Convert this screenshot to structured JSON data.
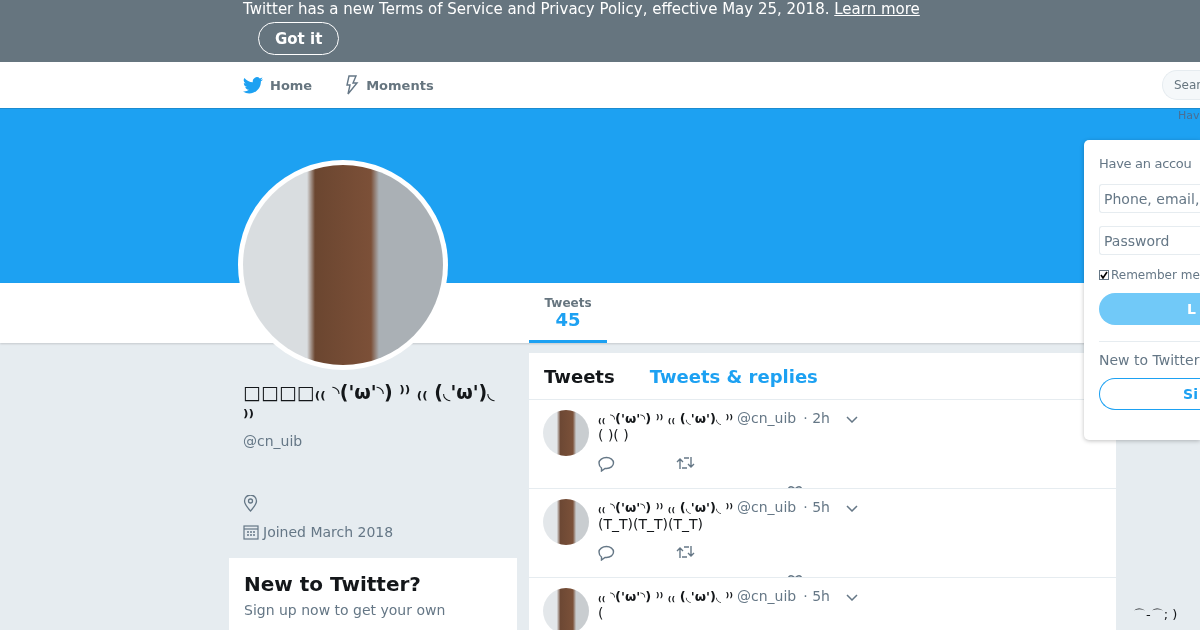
{
  "banner": {
    "text": "Twitter has a new Terms of Service and Privacy Policy, effective May 25, 2018.",
    "link": "Learn more",
    "button": "Got it"
  },
  "nav": {
    "items": [
      {
        "label": "Home"
      },
      {
        "label": "Moments"
      }
    ],
    "search": {
      "placeholder": "Sear"
    },
    "hint": "Hav"
  },
  "profile_nav": {
    "stats": [
      {
        "label": "Tweets",
        "value": "45",
        "selected": true
      }
    ]
  },
  "profile": {
    "name": "□□□□₍₍ ◝('ω'◝) ⁾⁾ ₍₍ (◟'ω')◟ ⁾⁾",
    "handle": "@cn_uib",
    "joined": "Joined March 2018"
  },
  "signup_card": {
    "title": "New to Twitter?",
    "text": "Sign up now to get your own"
  },
  "timeline": {
    "tabs": [
      {
        "label": "Tweets",
        "selected": true
      },
      {
        "label": "Tweets & replies",
        "selected": false
      }
    ],
    "tweets": [
      {
        "name": "₍₍ ◝('ω'◝) ⁾⁾ ₍₍ (◟'ω')◟ ⁾⁾",
        "handle": "@cn_uib",
        "time": "· 2h",
        "text": "( )( )"
      },
      {
        "name": "₍₍ ◝('ω'◝) ⁾⁾ ₍₍ (◟'ω')◟ ⁾⁾",
        "handle": "@cn_uib",
        "time": "· 5h",
        "text": "(T_T)(T_T)(T_T)"
      },
      {
        "name": "₍₍ ◝('ω'◝) ⁾⁾ ₍₍ (◟'ω')◟ ⁾⁾",
        "handle": "@cn_uib",
        "time": "· 5h",
        "text": "("
      }
    ]
  },
  "login": {
    "title": "Have an accou",
    "username_placeholder": "Phone, email,",
    "password_placeholder": "Password",
    "remember": {
      "label": "Remember me",
      "checked": true
    },
    "login_button": "L",
    "signup_prompt": "New to Twitter",
    "signup_button": "Si"
  },
  "corner_text": "⌒-⌒; )"
}
